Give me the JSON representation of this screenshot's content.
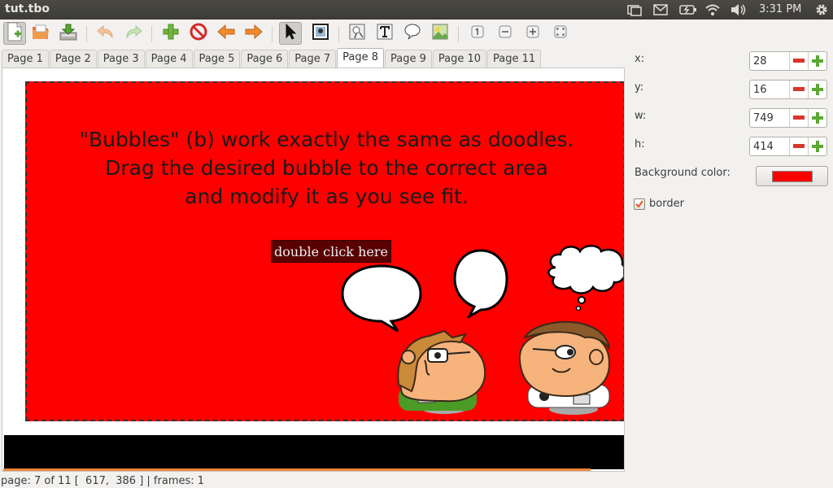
{
  "window": {
    "title": "tut.tbo"
  },
  "system": {
    "clock": "3:31 PM"
  },
  "tabs": [
    "Page 1",
    "Page 2",
    "Page 3",
    "Page 4",
    "Page 5",
    "Page 6",
    "Page 7",
    "Page 8",
    "Page 9",
    "Page 10",
    "Page 11"
  ],
  "active_tab": "Page 8",
  "canvas": {
    "text_lines": [
      "\"Bubbles\" (b) work exactly the same as doodles.",
      "Drag the desired bubble to the correct area",
      "and modify it as you see fit."
    ],
    "double_click_label": "double click here",
    "frame_color": "#ff0000"
  },
  "properties": {
    "x": {
      "label": "x:",
      "value": "28"
    },
    "y": {
      "label": "y:",
      "value": "16"
    },
    "w": {
      "label": "w:",
      "value": "749"
    },
    "h": {
      "label": "h:",
      "value": "414"
    },
    "background_color_label": "Background color:",
    "background_color": "#ff0000",
    "border_label": "border",
    "border_checked": true
  },
  "status": {
    "text": "page: 7 of 11 [  617,  386 ] | frames: 1"
  },
  "icons": {
    "toolbar": [
      "new-file-icon",
      "open-folder-icon",
      "save-icon",
      "undo-icon",
      "redo-icon",
      "add-page-icon",
      "delete-page-icon",
      "previous-page-icon",
      "next-page-icon",
      "selector-icon",
      "frame-tool-icon",
      "doodle-tool-icon",
      "text-tool-icon",
      "bubble-tool-icon",
      "image-tool-icon",
      "zoom-1-icon",
      "zoom-out-icon",
      "zoom-in-icon",
      "zoom-fit-icon"
    ],
    "tray": [
      "window-switch-icon",
      "mail-icon",
      "battery-icon",
      "wifi-icon",
      "volume-icon",
      "gear-icon"
    ]
  }
}
